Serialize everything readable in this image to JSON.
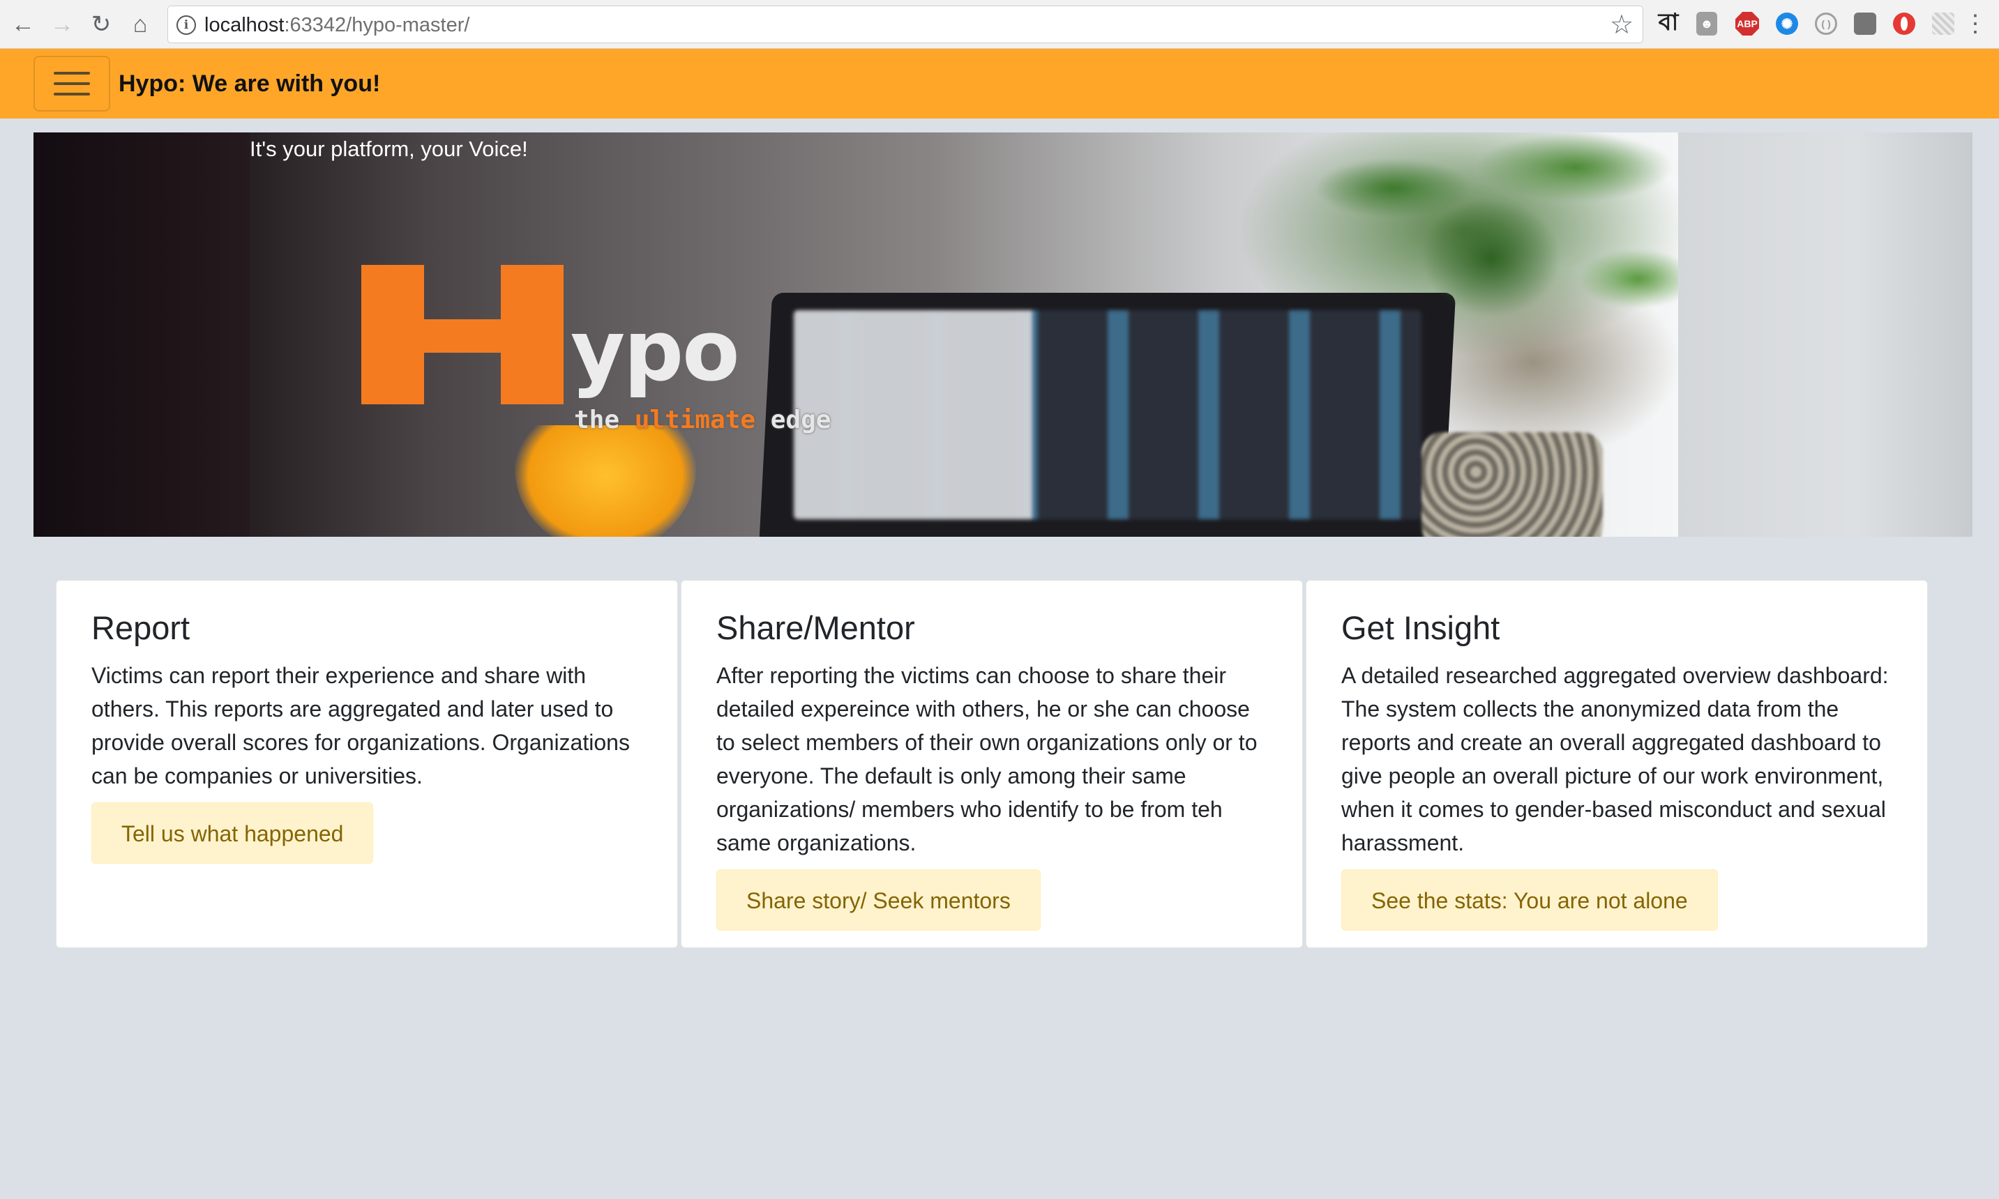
{
  "browser": {
    "url_host": "localhost",
    "url_rest": ":63342/hypo-master/",
    "extensions": [
      "bengali-keyboard-icon",
      "ghostery-icon",
      "adblock-plus-icon",
      "extension-blue-icon",
      "extension-circle-icon",
      "extension-dark-icon",
      "opera-icon",
      "extension-grid-icon"
    ]
  },
  "navbar": {
    "brand": "Hypo: We are with you!",
    "accent_color": "#ffa629"
  },
  "hero": {
    "tagline": "It's your platform, your Voice!",
    "logo_text": "ypo",
    "logo_tagline_pre": "the ",
    "logo_tagline_accent": "ultimate",
    "logo_tagline_post": " edge"
  },
  "cards": [
    {
      "title": "Report",
      "text": "Victims can report their experience and share with others. This reports are aggregated and later used to provide overall scores for organizations. Organizations can be companies or universities.",
      "button": "Tell us what happened"
    },
    {
      "title": "Share/Mentor",
      "text": "After reporting the victims can choose to share their detailed expereince with others, he or she can choose to select members of their own organizations only or to everyone. The default is only among their same organizations/ members who identify to be from teh same organizations.",
      "button": "Share story/ Seek mentors"
    },
    {
      "title": "Get Insight",
      "text": "A detailed researched aggregated overview dashboard: The system collects the anonymized data from the reports and create an overall aggregated dashboard to give people an overall picture of our work environment, when it comes to gender-based misconduct and sexual harassment.",
      "button": "See the stats: You are not alone"
    }
  ]
}
